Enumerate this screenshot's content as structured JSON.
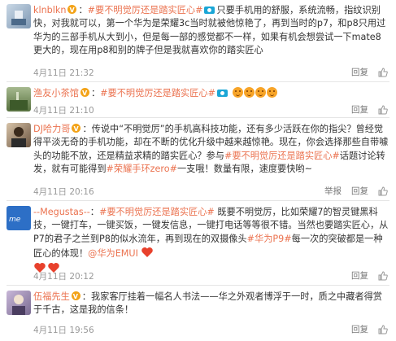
{
  "comments": [
    {
      "user": "klnblkn",
      "text_a": "：",
      "topic": "#要不明觉厉还是踏实匠心#",
      "text_b": "只要手机用的舒服，系统流畅，指纹识别快，对我就可以，第一个华为是荣耀3c当时就被他惊艳了，再到当时的p7，和p8只用过华为的三部手机从大到小，但是每一部的感觉都不一样，如果有机会想尝试一下mate8更大的，现在用p8和别的牌子但是我就喜欢你的踏实匠心",
      "time": "4月11日 21:32",
      "reply": "回复"
    },
    {
      "user": "渔友小茶馆",
      "text_a": "：",
      "topic": "#要不明觉厉还是踏实匠心#",
      "time": "4月11日 21:10",
      "reply": "回复"
    },
    {
      "user": "DJ哈力哥",
      "text_a": "：传说中“不明觉厉”的手机高科技功能，还有多少活跃在你的指尖？曾经觉得平淡无奇的手机功能，却在不断的优化升级中越来越惊艳。现在，你会选择那些自带噱头的功能不放，还是精益求精的踏实匠心？参与",
      "topic": "#要不明觉厉还是踏实匠心#",
      "text_b": "话题讨论转发，就有可能得到",
      "topic2": "#荣耀手环zero#",
      "text_c": "一支哦！数量有限，速度要快哟~",
      "time": "4月11日 20:16",
      "report": "举报",
      "reply": "回复"
    },
    {
      "user": "--Megustas--",
      "text_a": "：",
      "topic": "#要不明觉厉还是踏实匠心#",
      "text_b": " 既要不明觉厉，比如荣耀7的智灵键黑科技，一键打车，一键买饭，一键发信息，一键打电话等等很不错。当然也要踏实匠心，从P7的君子之兰到P8的似水流年，再到现在的双摄像头",
      "topic2": "#华为P9#",
      "text_c": "每一次的突破都是一种匠心的体现！",
      "mention": "@华为EMUI",
      "time": "4月11日 20:12",
      "reply": "回复"
    },
    {
      "user": "伍福先生",
      "text_a": "：我家客厅挂着一幅名人书法——华之外观者博浮于一时，质之中藏者得赏于千古，这是我的信条！",
      "time": "4月11日 19:56",
      "reply": "回复"
    }
  ],
  "colors": {
    "accent": "#eb7350",
    "meta": "#999999",
    "divider": "#e5e5e5",
    "heart": "#e8412c"
  }
}
